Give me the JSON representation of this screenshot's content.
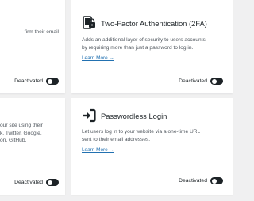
{
  "cards": [
    {
      "id": "email-confirmation",
      "description_lines": [
        "firm their email"
      ],
      "status_label": "Deactivated"
    },
    {
      "id": "two-factor",
      "title": "Two-Factor Authentication (2FA)",
      "description_lines": [
        "Adds an additional layer of security to users accounts,",
        "by requiring more than just a password to log in."
      ],
      "learn_more": "Learn More →",
      "status_label": "Deactivated",
      "icon": "phone-lock-icon"
    },
    {
      "id": "social-login",
      "description_lines": [
        "our site using their",
        "k, Twitter, Google,",
        "on, GitHub,"
      ],
      "status_label": "Deactivated"
    },
    {
      "id": "passwordless-login",
      "title": "Passwordless Login",
      "description_lines": [
        "Let users log in to your website via a one-time URL",
        "sent to their email addresses."
      ],
      "learn_more": "Learn More →",
      "status_label": "Deactivated",
      "icon": "sign-in-icon"
    }
  ],
  "colors": {
    "background": "#f0f0f1",
    "card": "#ffffff",
    "link": "#2271b1",
    "toggle": "#1d2327"
  }
}
